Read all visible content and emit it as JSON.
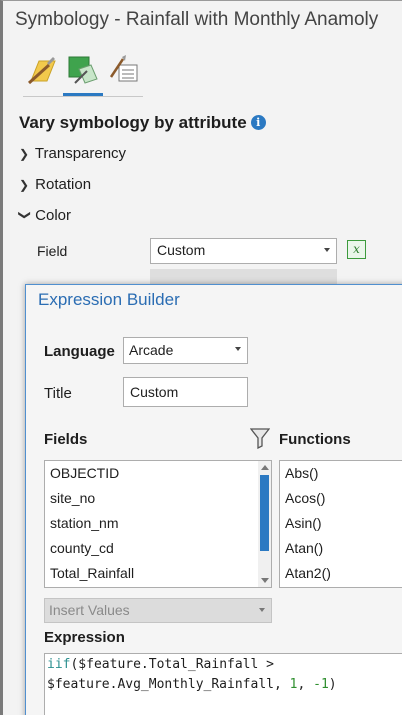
{
  "pane": {
    "title": "Symbology - Rainfall with Monthly Anamoly",
    "tabs": [
      {
        "name": "primary-symbology",
        "icon": "paintbrush-icon"
      },
      {
        "name": "vary-by-attribute",
        "icon": "layer-paint-icon",
        "active": true
      },
      {
        "name": "symbol-layers",
        "icon": "list-brush-icon"
      }
    ],
    "heading": "Vary symbology by attribute",
    "sections": {
      "transparency": "Transparency",
      "rotation": "Rotation",
      "color": "Color"
    },
    "field_label": "Field",
    "field_value": "Custom"
  },
  "expression_builder": {
    "title": "Expression Builder",
    "language_label": "Language",
    "language_value": "Arcade",
    "title_label": "Title",
    "title_value": "Custom",
    "fields_label": "Fields",
    "functions_label": "Functions",
    "fields": [
      "OBJECTID",
      "site_no",
      "station_nm",
      "county_cd",
      "Total_Rainfall"
    ],
    "functions": [
      "Abs()",
      "Acos()",
      "Asin()",
      "Atan()",
      "Atan2()"
    ],
    "insert_values_label": "Insert Values",
    "expression_label": "Expression",
    "expression": {
      "line1_fn": "iif",
      "line1_rest": "($feature.Total_Rainfall >",
      "line2_pre": "$feature.Avg_Monthly_Rainfall, ",
      "val_true": "1",
      "sep": ", ",
      "val_false": "-1",
      "close": ")"
    }
  },
  "colors": {
    "accent": "#2b79c2",
    "dialog_title": "#2b6db3",
    "keyword": "#2b8f8f",
    "number": "#2f8f2f"
  }
}
